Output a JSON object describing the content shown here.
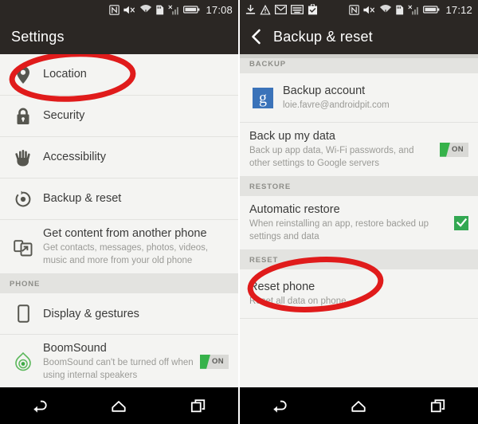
{
  "colors": {
    "status_bar": "#2b2724",
    "accent_green": "#36b24a",
    "annotation_red": "#e01b1b",
    "google_blue": "#3b73b9",
    "list_bg": "#f4f4f2",
    "section_bg": "#e3e3e0"
  },
  "left_screen": {
    "status_bar": {
      "time": "17:08",
      "left_icons": [],
      "right_icons": [
        "nfc-icon",
        "mute-icon",
        "wifi-icon",
        "sd-card-icon",
        "signal-icon",
        "battery-icon"
      ]
    },
    "title": "Settings",
    "items": [
      {
        "icon": "location-pin-icon",
        "title": "Location",
        "subtitle": ""
      },
      {
        "icon": "lock-icon",
        "title": "Security",
        "subtitle": ""
      },
      {
        "icon": "hand-icon",
        "title": "Accessibility",
        "subtitle": ""
      },
      {
        "icon": "backup-reset-icon",
        "title": "Backup & reset",
        "subtitle": "",
        "highlighted": true
      },
      {
        "icon": "transfer-phone-icon",
        "title": "Get content from another phone",
        "subtitle": "Get contacts, messages, photos, videos, music and more from your old phone"
      }
    ],
    "section_phone": "PHONE",
    "phone_items": [
      {
        "icon": "display-icon",
        "title": "Display & gestures",
        "subtitle": "",
        "toggle": null
      },
      {
        "icon": "boomsound-icon",
        "title": "BoomSound",
        "subtitle": "BoomSound can't be turned off when using internal speakers",
        "toggle": "ON"
      }
    ],
    "nav": [
      "back-button",
      "home-button",
      "recents-button"
    ]
  },
  "right_screen": {
    "status_bar": {
      "time": "17:12",
      "left_icons": [
        "download-icon",
        "warning-icon",
        "mail-icon",
        "keyboard-icon",
        "task-icon"
      ],
      "right_icons": [
        "nfc-icon",
        "mute-icon",
        "wifi-icon",
        "sd-card-icon",
        "signal-icon",
        "battery-icon"
      ]
    },
    "title": "Backup & reset",
    "back_label": "back-chevron",
    "sections": [
      {
        "header": "BACKUP",
        "items": [
          {
            "icon": "google-g-icon",
            "title": "Backup account",
            "subtitle": "loie.favre@androidpit.com",
            "control": "none"
          },
          {
            "icon": "none",
            "title": "Back up my data",
            "subtitle": "Back up app data, Wi-Fi passwords, and other settings to Google servers",
            "control": "toggle",
            "toggle_label": "ON"
          }
        ]
      },
      {
        "header": "RESTORE",
        "items": [
          {
            "icon": "none",
            "title": "Automatic restore",
            "subtitle": "When reinstalling an app, restore backed up settings and data",
            "control": "checkbox",
            "checked": true
          }
        ]
      },
      {
        "header": "RESET",
        "items": [
          {
            "icon": "none",
            "title": "Reset phone",
            "subtitle": "Reset all data on phone",
            "control": "none",
            "highlighted": true
          }
        ]
      }
    ],
    "nav": [
      "back-button",
      "home-button",
      "recents-button"
    ]
  }
}
